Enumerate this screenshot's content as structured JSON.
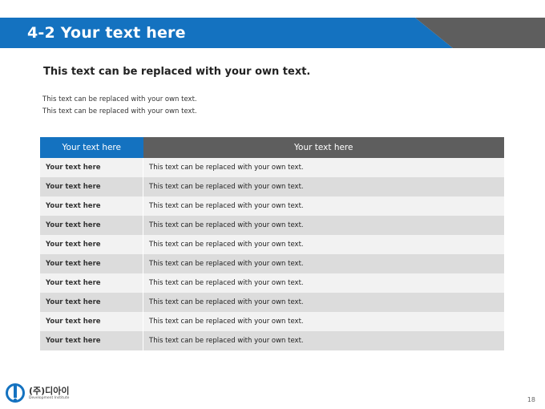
{
  "header": {
    "title": "4-2 Your text here",
    "accent_color": "#1472c0",
    "dark_color": "#5e5e5e"
  },
  "subtitle": "This text can be replaced with your own text.",
  "body_lines": [
    "This text can be replaced with your own text.",
    "This text can be replaced with your own text."
  ],
  "table": {
    "headers": [
      "Your text here",
      "Your text here"
    ],
    "rows": [
      [
        "Your text here",
        "This text can be replaced with your own text."
      ],
      [
        "Your text here",
        "This text can be replaced with your own text."
      ],
      [
        "Your text here",
        "This text can be replaced with your own text."
      ],
      [
        "Your text here",
        "This text can be replaced with your own text."
      ],
      [
        "Your text here",
        "This text can be replaced with your own text."
      ],
      [
        "Your text here",
        "This text can be replaced with your own text."
      ],
      [
        "Your text here",
        "This text can be replaced with your own text."
      ],
      [
        "Your text here",
        "This text can be replaced with your own text."
      ],
      [
        "Your text here",
        "This text can be replaced with your own text."
      ],
      [
        "Your text here",
        "This text can be replaced with your own text."
      ]
    ]
  },
  "footer": {
    "logo_name": "(주)디아이",
    "logo_sub": "Development Institute",
    "page_number": "18"
  }
}
